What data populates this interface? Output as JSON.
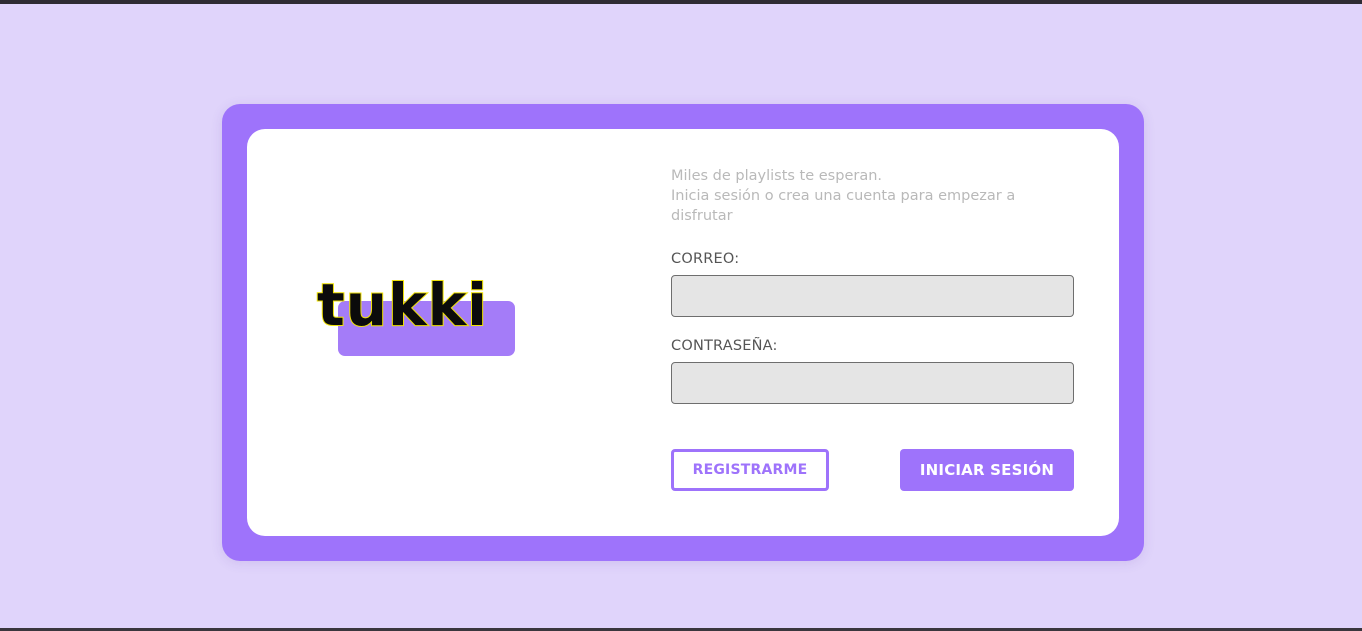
{
  "app": {
    "logo_text": "tukki"
  },
  "intro": {
    "line1": "Miles de playlists te esperan.",
    "line2": "Inicia sesión o crea una cuenta para empezar a disfrutar"
  },
  "form": {
    "email_label": "CORREO:",
    "email_value": "",
    "password_label": "CONTRASEÑA:",
    "password_value": "",
    "register_label": "REGISTRARME",
    "login_label": "INICIAR SESIÓN"
  },
  "colors": {
    "page_background": "#e0d4fb",
    "accent": "#9e73fb",
    "logo_fill": "#0b0b0b",
    "logo_outline": "#f0e20a",
    "card_background": "#ffffff",
    "input_background": "#e5e5e5"
  }
}
